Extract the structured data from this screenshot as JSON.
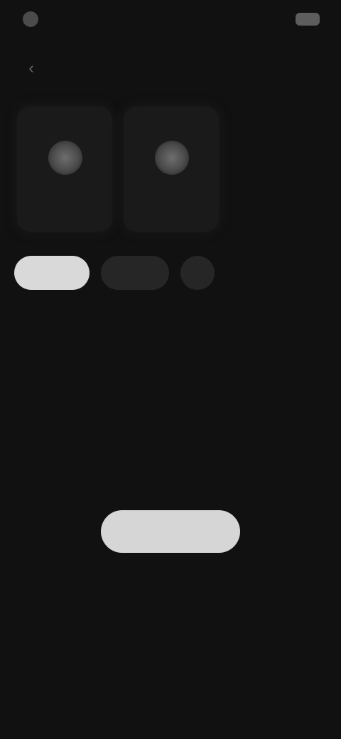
{
  "status_bar": {
    "time": "",
    "icons": ""
  },
  "header": {
    "back_icon": "chevron-left-icon",
    "title": ""
  },
  "cards": [
    {
      "label": ""
    },
    {
      "label": ""
    }
  ],
  "filters": [
    {
      "label": "",
      "active": true
    },
    {
      "label": "",
      "active": false
    },
    {
      "label": "",
      "active": false
    }
  ],
  "empty_state": {
    "title": "",
    "subtitle": ""
  },
  "primary_button": {
    "label": ""
  },
  "colors": {
    "background": "#111111",
    "active_chip": "#d9d9d9",
    "primary_button": "#d6d6d6"
  }
}
